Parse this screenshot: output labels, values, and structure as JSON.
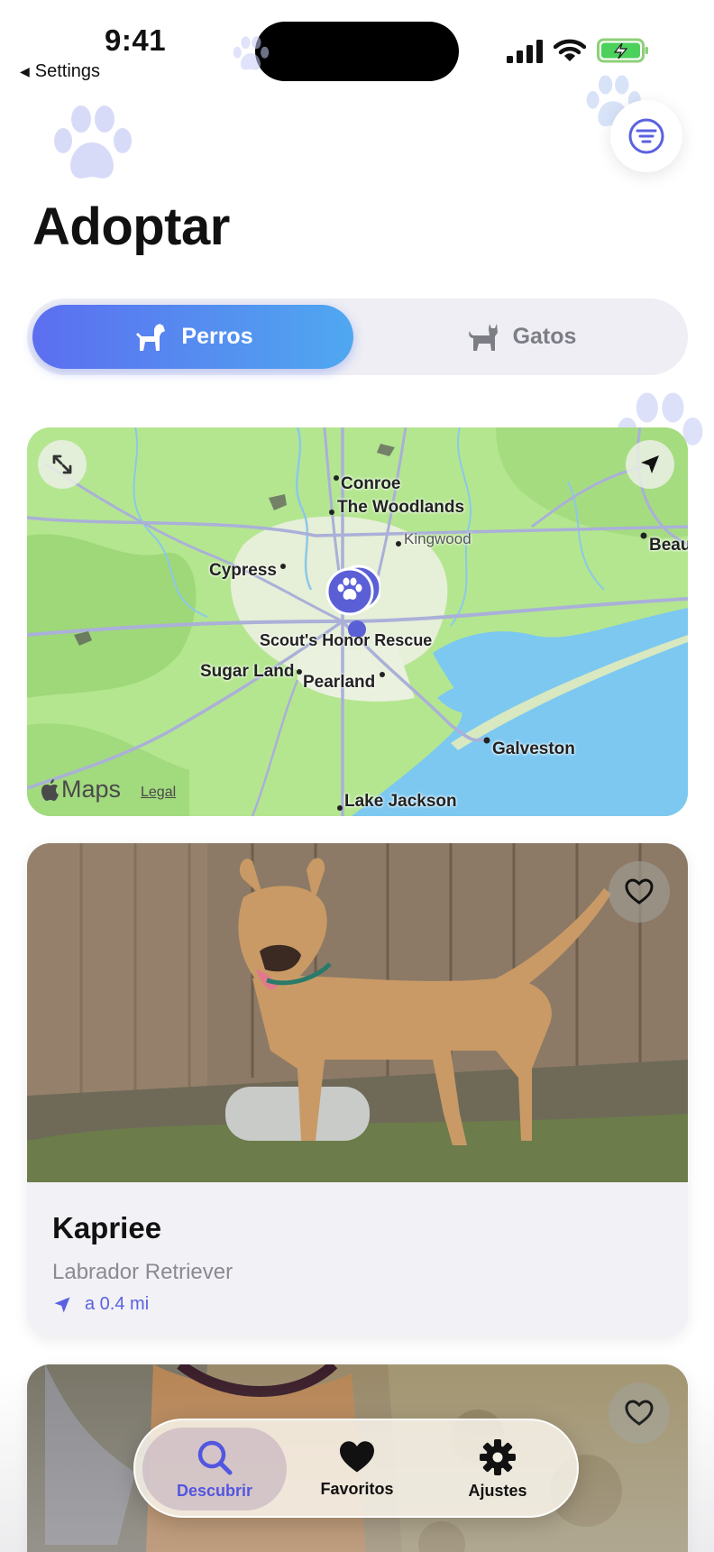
{
  "status_bar": {
    "time": "9:41",
    "back_label": "Settings",
    "icons": [
      "cellular-signal-icon",
      "wifi-icon",
      "battery-charging-icon"
    ]
  },
  "header": {
    "title": "Adoptar",
    "filter_icon": "filter-lines-icon"
  },
  "segment": {
    "options": [
      {
        "label": "Perros",
        "icon": "dog-icon",
        "selected": true
      },
      {
        "label": "Gatos",
        "icon": "cat-icon",
        "selected": false
      }
    ]
  },
  "map": {
    "places": {
      "conroe": "Conroe",
      "woodlands": "The Woodlands",
      "kingwood": "Kingwood",
      "beaumont": "Beau",
      "cypress": "Cypress",
      "shelter": "Scout's Honor Rescue",
      "sugar_land": "Sugar Land",
      "pearland": "Pearland",
      "galveston": "Galveston",
      "lake_jackson": "Lake Jackson"
    },
    "maps_label": "Maps",
    "legal": "Legal",
    "expand_icon": "expand-arrows-icon",
    "locate_icon": "location-arrow-icon",
    "pin_icon": "paw-pin-icon"
  },
  "pets": [
    {
      "name": "Kapriee",
      "breed": "Labrador Retriever",
      "distance": "a 0.4 mi",
      "favorite": false
    },
    {
      "favorite": false
    }
  ],
  "tabbar": {
    "tabs": [
      {
        "label": "Descubrir",
        "icon": "search-icon",
        "active": true
      },
      {
        "label": "Favoritos",
        "icon": "heart-icon",
        "active": false
      },
      {
        "label": "Ajustes",
        "icon": "gear-icon",
        "active": false
      }
    ]
  },
  "colors": {
    "accent": "#5a62e0",
    "gradient_start": "#5c6ef0",
    "gradient_end": "#4fa8f0",
    "map_land": "#aee48a",
    "water": "#7cc8f0"
  }
}
